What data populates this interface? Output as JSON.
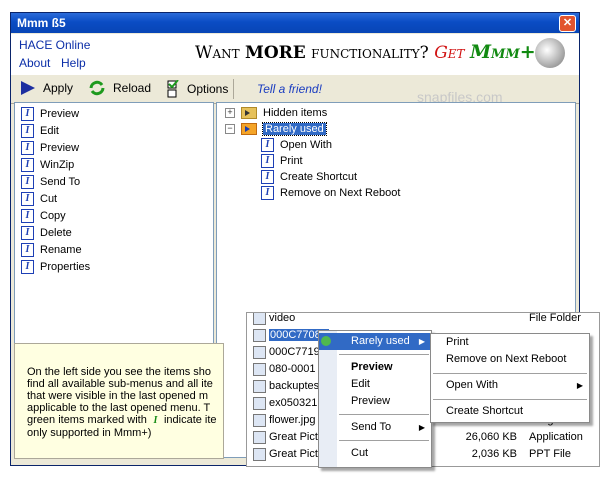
{
  "window": {
    "title": "Mmm ß5",
    "close_glyph": "✕"
  },
  "menu": {
    "hace_online": "HACE Online",
    "about": "About",
    "help": "Help"
  },
  "banner": {
    "slogan_want": "Want ",
    "slogan_more": "MORE",
    "slogan_func": " functionality? ",
    "slogan_get": "Get",
    "logo_text": "Mmm+"
  },
  "watermark": "snapfiles.com",
  "toolbar": {
    "apply": "Apply",
    "reload": "Reload",
    "options": "Options",
    "tell_friend": "Tell a friend!"
  },
  "left_items": [
    "Preview",
    "Edit",
    "Preview",
    "WinZip",
    "Send To",
    "Cut",
    "Copy",
    "Delete",
    "Rename",
    "Properties"
  ],
  "tree": {
    "hidden": "Hidden items",
    "rarely": "Rarely used",
    "children": [
      "Open With",
      "Print",
      "Create Shortcut",
      "Remove on Next Reboot"
    ]
  },
  "info_lines": [
    "On the left side you see the items sho",
    "find all available sub-menus and all ite",
    "that were visible in the last opened m",
    "applicable to the last opened menu. T",
    "green items marked with",
    "indicate ite",
    "only supported in Mmm+)"
  ],
  "explorer": {
    "files": [
      "video",
      "000C7708",
      "000C7719",
      "080-0001",
      "backuptes",
      "ex050321",
      "flower.jpg",
      "Great Pict",
      "Great Pict"
    ],
    "right_col": [
      {
        "size": "",
        "type": "File Folder"
      },
      {
        "size": "",
        "type": "ent"
      },
      {
        "size": "",
        "type": "Image"
      },
      {
        "size": "26,060 KB",
        "type": "Application"
      },
      {
        "size": "2,036 KB",
        "type": "PPT File"
      }
    ]
  },
  "context_menu": {
    "rarely": "Rarely used",
    "items": [
      "Preview",
      "Edit",
      "Preview",
      "Send To",
      "Cut"
    ]
  },
  "submenu": [
    "Print",
    "Remove on Next Reboot",
    "Open With",
    "Create Shortcut"
  ]
}
